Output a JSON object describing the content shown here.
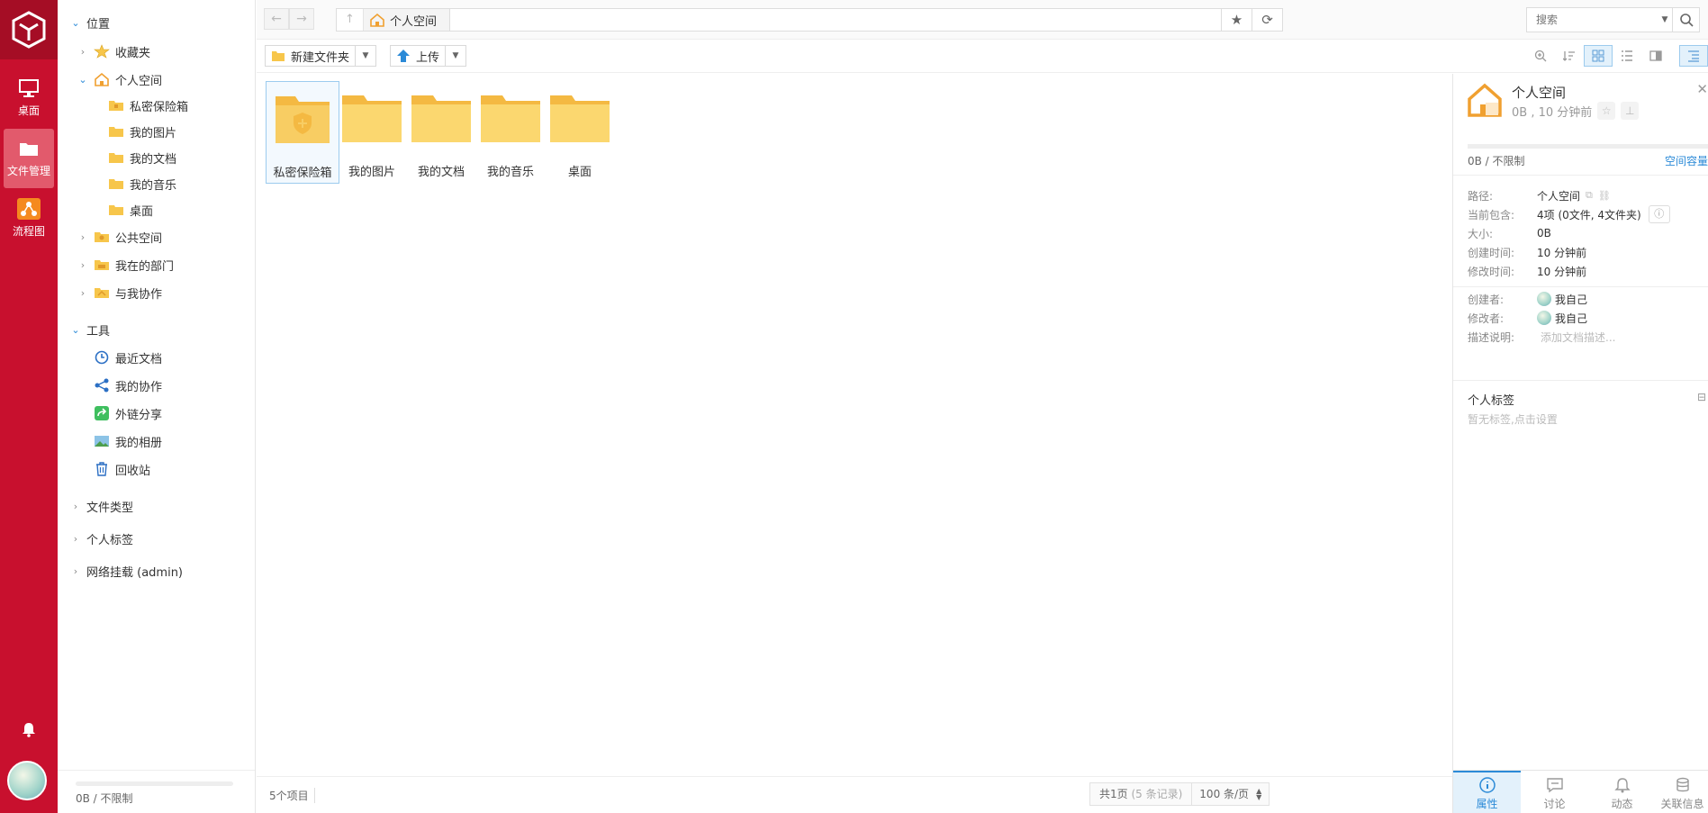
{
  "rail": {
    "items": [
      {
        "label": "桌面",
        "icon": "monitor-icon"
      },
      {
        "label": "文件管理",
        "icon": "folder-icon",
        "active": true
      },
      {
        "label": "流程图",
        "icon": "flowchart-icon"
      }
    ]
  },
  "tree": {
    "location_label": "位置",
    "favorites": "收藏夹",
    "personal_space": "个人空间",
    "children": [
      "私密保险箱",
      "我的图片",
      "我的文档",
      "我的音乐",
      "桌面"
    ],
    "public_space": "公共空间",
    "my_department": "我在的部门",
    "shared_with_me": "与我协作",
    "tools_label": "工具",
    "tools": [
      "最近文档",
      "我的协作",
      "外链分享",
      "我的相册",
      "回收站"
    ],
    "file_types": "文件类型",
    "personal_tags": "个人标签",
    "network_mount": "网络挂载 (admin)",
    "footer_quota": "0B / 不限制"
  },
  "topbar": {
    "back": "←",
    "forward": "→",
    "up": "↑",
    "breadcrumb": "个人空间",
    "search_placeholder": "搜索"
  },
  "toolbar": {
    "new_folder": "新建文件夹",
    "upload": "上传"
  },
  "files": [
    {
      "name": "私密保险箱",
      "type": "vault",
      "selected": true
    },
    {
      "name": "我的图片",
      "type": "folder"
    },
    {
      "name": "我的文档",
      "type": "folder"
    },
    {
      "name": "我的音乐",
      "type": "folder"
    },
    {
      "name": "桌面",
      "type": "folder"
    }
  ],
  "status": {
    "count": "5个项目",
    "pages_prefix": "共1页",
    "records": "(5 条记录)",
    "per_page": "100 条/页"
  },
  "panel": {
    "title": "个人空间",
    "subtitle": "0B , 10 分钟前",
    "quota": "0B / 不限制",
    "quota_link": "空间容量",
    "props": [
      {
        "k": "路径:",
        "v": "个人空间"
      },
      {
        "k": "当前包含:",
        "v": "4项 (0文件, 4文件夹)"
      },
      {
        "k": "大小:",
        "v": "0B"
      },
      {
        "k": "创建时间:",
        "v": "10 分钟前"
      },
      {
        "k": "修改时间:",
        "v": "10 分钟前"
      }
    ],
    "people": [
      {
        "k": "创建者:",
        "v": "我自己"
      },
      {
        "k": "修改者:",
        "v": "我自己"
      },
      {
        "k": "描述说明:",
        "v": "添加文档描述..."
      }
    ],
    "tags_title": "个人标签",
    "tags_empty": "暂无标签,点击设置",
    "tabs": [
      "属性",
      "讨论",
      "动态",
      "关联信息"
    ]
  },
  "colors": {
    "brand": "#c8102e",
    "accent": "#2b8ad7",
    "folder": "#f7c64b"
  }
}
